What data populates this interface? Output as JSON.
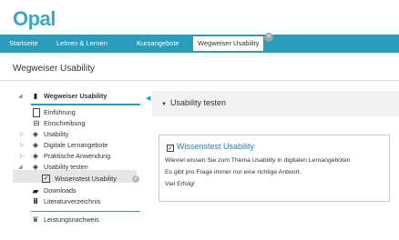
{
  "app": {
    "logo_text": "Opal",
    "brand_color": "#2a9dbd"
  },
  "nav": {
    "items": [
      {
        "label": "Startseite"
      },
      {
        "label": "Lehren & Lernen"
      },
      {
        "label": "Kursangebote"
      },
      {
        "label": "Wegweiser Usability",
        "active": true
      }
    ]
  },
  "page": {
    "title": "Wegweiser Usability"
  },
  "sidebar": {
    "root_label": "Wegweiser Usability",
    "items": [
      {
        "label": "Einführung",
        "icon": "page-icon"
      },
      {
        "label": "Einschreibung",
        "icon": "enroll-icon"
      },
      {
        "label": "Usability",
        "icon": "layers-icon"
      },
      {
        "label": "Digitale Lernangebote",
        "icon": "layers-icon"
      },
      {
        "label": "Praktische Anwendung",
        "icon": "layers-icon"
      },
      {
        "label": "Usability testen",
        "icon": "layers-icon"
      },
      {
        "label": "Wissenstest Usability",
        "icon": "checkbox-icon"
      },
      {
        "label": "Downloads",
        "icon": "folder-icon"
      },
      {
        "label": "Literaturverzeichnis",
        "icon": "library-icon"
      },
      {
        "label": "Leistungsnachweis",
        "icon": "trophy-icon"
      }
    ]
  },
  "content": {
    "heading": "Usability testen",
    "test": {
      "title": "Wissenstest Usability",
      "line1": "Wieviel wissen Sie zum Thema Usability in digitalen Lernangeboten",
      "line2": "Es gibt pro Frage immer nur eine richtige Antwort.",
      "line3": "Viel Erfolg!"
    }
  }
}
